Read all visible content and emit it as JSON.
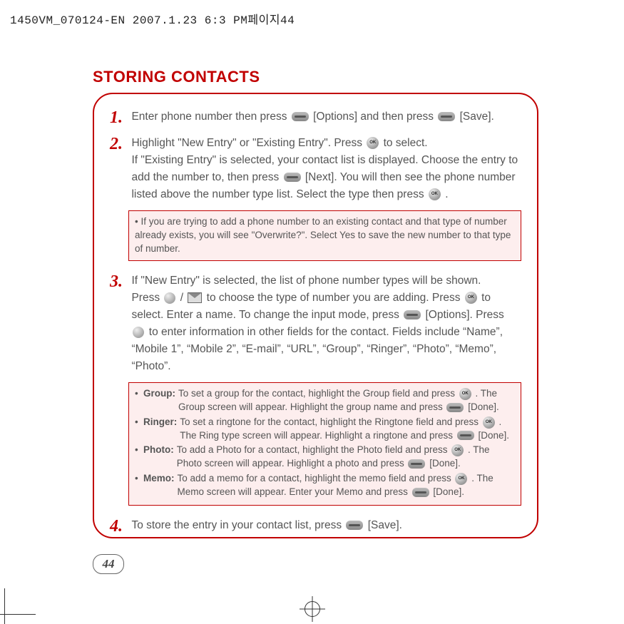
{
  "header": "1450VM_070124-EN  2007.1.23 6:3 PM페이지44",
  "section_title": "STORING CONTACTS",
  "steps": {
    "s1": {
      "num": "1.",
      "t1": "Enter phone number then press ",
      "t2": " [Options] and then press ",
      "t3": " [Save]."
    },
    "s2": {
      "num": "2.",
      "t1": "Highlight \"New Entry\" or \"Existing Entry\".  Press ",
      "t2": " to select.",
      "t3": "If \"Existing Entry\" is selected, your contact list is displayed.  Choose the entry to add the number to, then press ",
      "t4": " [Next].  You will then see the phone number listed above the number type list.  Select the type then press ",
      "t5": " ."
    },
    "note1": "• If you are trying to add a phone number to an existing contact and that type of number already exists, you will see \"Overwrite?\".  Select Yes to save the new number to that type of number.",
    "s3": {
      "num": "3.",
      "t1": "If \"New Entry\" is selected, the list of phone number types will be shown.",
      "t2": "Press ",
      "t3": " / ",
      "t4": " to choose the type of number you are adding.  Press ",
      "t5": " to select.  Enter a name.  To change the input mode, press ",
      "t6": " [Options].  Press ",
      "t7": " to enter information in other fields for the contact.  Fields include “Name”, “Mobile 1”, “Mobile 2”, “E-mail”, “URL”, “Group”, “Ringer”, “Photo”, “Memo”, “Photo”."
    },
    "note2": {
      "group_label": "Group:",
      "group_a": "To set a group for the contact, highlight the Group field and press ",
      "group_b": " .  The Group screen will appear.  Highlight the group name and press ",
      "group_c": " [Done].",
      "ringer_label": "Ringer:",
      "ringer_a": "To set a ringtone for the contact, highlight the Ringtone field and press ",
      "ringer_b": " .  The Ring type screen will appear.  Highlight a ringtone and press ",
      "ringer_c": " [Done].",
      "photo_label": "Photo:",
      "photo_a": "To add a Photo for a contact, highlight the Photo field and press ",
      "photo_b": " .  The Photo screen will appear.  Highlight a photo and press ",
      "photo_c": " [Done].",
      "memo_label": "Memo:",
      "memo_a": "To add a memo for a contact, highlight the memo field and press ",
      "memo_b": " .  The Memo screen will appear.  Enter your Memo and press ",
      "memo_c": " [Done]."
    },
    "s4": {
      "num": "4.",
      "t1": "To store the entry in your contact list, press ",
      "t2": " [Save]."
    }
  },
  "page_number": "44"
}
